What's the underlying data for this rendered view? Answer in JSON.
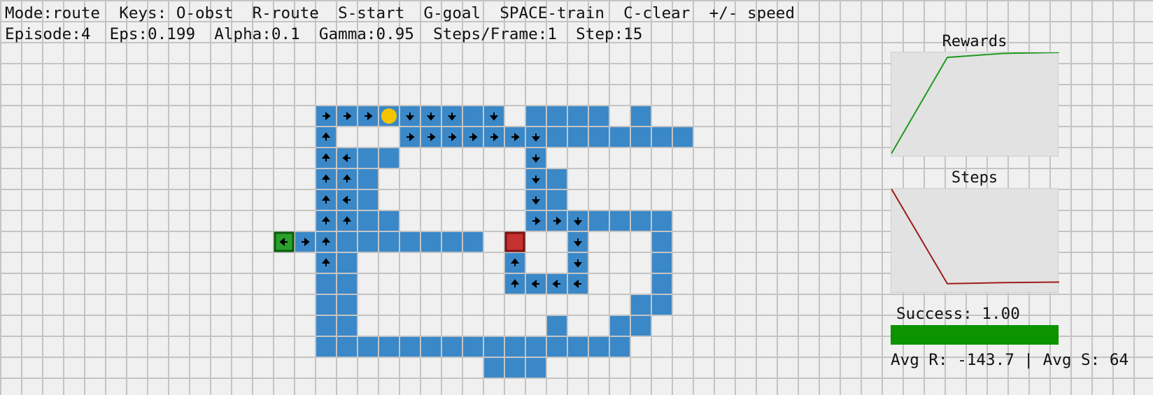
{
  "status": {
    "line1": "Mode:route  Keys: O-obst  R-route  S-start  G-goal  SPACE-train  C-clear  +/- speed",
    "line2": "Episode:4  Eps:0.199  Alpha:0.1  Gamma:0.95  Steps/Frame:1  Step:15"
  },
  "grid": {
    "cell_size": 30,
    "route_color": "#3a88c8",
    "start_color": "#2aa12a",
    "goal_color": "#c43131",
    "agent_color": "#f5c400",
    "route_rows": [
      [
        5,
        [
          [
            15,
            23
          ],
          [
            25,
            28
          ],
          [
            30,
            30
          ]
        ]
      ],
      [
        6,
        [
          [
            15,
            15
          ],
          [
            19,
            32
          ]
        ]
      ],
      [
        7,
        [
          [
            15,
            18
          ],
          [
            25,
            25
          ]
        ]
      ],
      [
        8,
        [
          [
            15,
            17
          ],
          [
            25,
            26
          ]
        ]
      ],
      [
        9,
        [
          [
            15,
            17
          ],
          [
            25,
            26
          ]
        ]
      ],
      [
        10,
        [
          [
            15,
            18
          ],
          [
            25,
            31
          ]
        ]
      ],
      [
        11,
        [
          [
            14,
            22
          ],
          [
            27,
            27
          ],
          [
            31,
            31
          ]
        ]
      ],
      [
        12,
        [
          [
            15,
            16
          ],
          [
            24,
            24
          ],
          [
            27,
            27
          ],
          [
            31,
            31
          ]
        ]
      ],
      [
        13,
        [
          [
            15,
            16
          ],
          [
            24,
            27
          ],
          [
            31,
            31
          ]
        ]
      ],
      [
        14,
        [
          [
            15,
            16
          ],
          [
            30,
            31
          ]
        ]
      ],
      [
        15,
        [
          [
            15,
            16
          ],
          [
            26,
            26
          ],
          [
            29,
            30
          ]
        ]
      ],
      [
        16,
        [
          [
            15,
            29
          ]
        ]
      ],
      [
        17,
        [
          [
            23,
            25
          ]
        ]
      ]
    ],
    "start_cell": [
      13,
      11
    ],
    "goal_cell": [
      24,
      11
    ],
    "agent_cell": [
      18,
      5
    ],
    "arrows": [
      [
        15,
        5,
        "right"
      ],
      [
        16,
        5,
        "right"
      ],
      [
        17,
        5,
        "right"
      ],
      [
        19,
        5,
        "down"
      ],
      [
        20,
        5,
        "down"
      ],
      [
        21,
        5,
        "down"
      ],
      [
        23,
        5,
        "down"
      ],
      [
        15,
        6,
        "up"
      ],
      [
        19,
        6,
        "right"
      ],
      [
        20,
        6,
        "right"
      ],
      [
        21,
        6,
        "right"
      ],
      [
        22,
        6,
        "right"
      ],
      [
        23,
        6,
        "right"
      ],
      [
        24,
        6,
        "right"
      ],
      [
        25,
        6,
        "down"
      ],
      [
        15,
        7,
        "up"
      ],
      [
        16,
        7,
        "left"
      ],
      [
        25,
        7,
        "down"
      ],
      [
        15,
        8,
        "up"
      ],
      [
        16,
        8,
        "up"
      ],
      [
        25,
        8,
        "down"
      ],
      [
        15,
        9,
        "up"
      ],
      [
        16,
        9,
        "left"
      ],
      [
        25,
        9,
        "down"
      ],
      [
        15,
        10,
        "up"
      ],
      [
        16,
        10,
        "up"
      ],
      [
        25,
        10,
        "right"
      ],
      [
        26,
        10,
        "right"
      ],
      [
        27,
        10,
        "down"
      ],
      [
        13,
        11,
        "left"
      ],
      [
        14,
        11,
        "right"
      ],
      [
        15,
        11,
        "up"
      ],
      [
        27,
        11,
        "down"
      ],
      [
        15,
        12,
        "up"
      ],
      [
        24,
        12,
        "up"
      ],
      [
        27,
        12,
        "down"
      ],
      [
        24,
        13,
        "up"
      ],
      [
        25,
        13,
        "left"
      ],
      [
        26,
        13,
        "left"
      ],
      [
        27,
        13,
        "left"
      ]
    ]
  },
  "rewards_chart": {
    "title": "Rewards",
    "type": "line",
    "color": "#1f9a1f",
    "values": [
      -820,
      -40,
      -8,
      0
    ],
    "ylim": [
      -850,
      0
    ]
  },
  "steps_chart": {
    "title": "Steps",
    "type": "line",
    "color": "#9e1c1c",
    "values": [
      200,
      19,
      21,
      22
    ],
    "ylim": [
      0,
      200
    ]
  },
  "success": {
    "label": "Success: 1.00",
    "value": 1.0,
    "color": "#0b9300"
  },
  "averages": {
    "text": "Avg R: -143.7 | Avg S: 64"
  }
}
